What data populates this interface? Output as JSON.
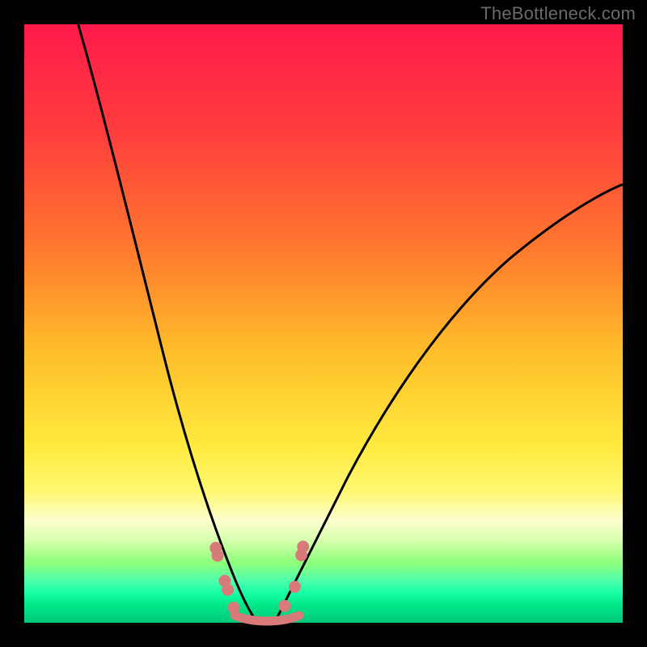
{
  "watermark": "TheBottleneck.com",
  "chart_data": {
    "type": "line",
    "title": "",
    "xlabel": "",
    "ylabel": "",
    "xlim": [
      0,
      100
    ],
    "ylim": [
      0,
      100
    ],
    "grid": false,
    "legend": false,
    "series": [
      {
        "name": "left-curve",
        "stroke": "#000000",
        "x": [
          9,
          11,
          13,
          15,
          17,
          19,
          21,
          23,
          25,
          27,
          29,
          31,
          33,
          35,
          37
        ],
        "y": [
          100,
          92,
          84,
          76,
          68,
          60,
          52,
          44,
          37,
          30,
          23,
          17,
          11,
          6,
          2
        ]
      },
      {
        "name": "right-curve",
        "stroke": "#000000",
        "x": [
          43,
          45,
          48,
          51,
          55,
          59,
          64,
          69,
          75,
          82,
          89,
          96,
          100
        ],
        "y": [
          2,
          6,
          11,
          17,
          24,
          31,
          38,
          45,
          52,
          59,
          65,
          70,
          73
        ]
      },
      {
        "name": "markers",
        "stroke": "#d97a7a",
        "fill": "#d97a7a",
        "marker_only": true,
        "x": [
          32.0,
          32.3,
          33.5,
          34.0,
          35.0,
          37.5,
          40.5,
          43.5,
          45.2,
          46.3,
          46.6
        ],
        "y": [
          12.5,
          11.2,
          7.0,
          5.5,
          2.5,
          1.0,
          1.0,
          2.8,
          6.0,
          11.3,
          12.7
        ]
      },
      {
        "name": "bottom-band",
        "stroke": "#d97a7a",
        "x": [
          35,
          37,
          39,
          41,
          43
        ],
        "y": [
          1.0,
          0.7,
          0.7,
          0.7,
          1.0
        ]
      }
    ]
  }
}
